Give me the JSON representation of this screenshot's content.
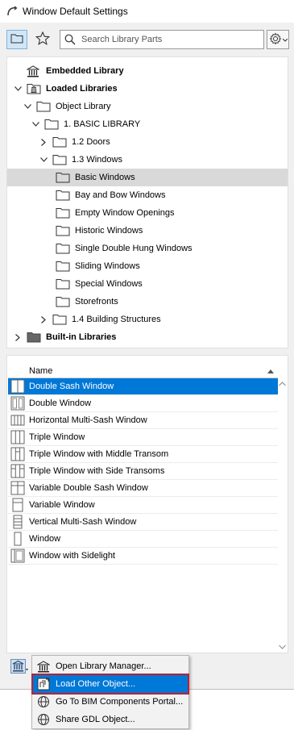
{
  "window": {
    "title": "Window Default Settings"
  },
  "toolbar": {
    "folder_tooltip": "folder-view",
    "favorites_tooltip": "favorites",
    "search_placeholder": "Search Library Parts"
  },
  "tree": {
    "items": [
      {
        "label": "Embedded Library",
        "bold": true
      },
      {
        "label": "Loaded Libraries",
        "bold": true
      },
      {
        "label": "Object Library"
      },
      {
        "label": "1. BASIC LIBRARY"
      },
      {
        "label": "1.2 Doors"
      },
      {
        "label": "1.3 Windows"
      },
      {
        "label": "Basic Windows"
      },
      {
        "label": "Bay and Bow Windows"
      },
      {
        "label": "Empty Window Openings"
      },
      {
        "label": "Historic Windows"
      },
      {
        "label": "Single Double Hung Windows"
      },
      {
        "label": "Sliding Windows"
      },
      {
        "label": "Special Windows"
      },
      {
        "label": "Storefronts"
      },
      {
        "label": "1.4 Building Structures"
      },
      {
        "label": "Built-in Libraries",
        "bold": true
      }
    ]
  },
  "list": {
    "column_name": "Name",
    "rows": [
      "Double Sash Window",
      "Double Window",
      "Horizontal Multi-Sash Window",
      "Triple Window",
      "Triple Window with Middle Transom",
      "Triple Window with Side Transoms",
      "Variable Double Sash Window",
      "Variable Window",
      "Vertical Multi-Sash Window",
      "Window",
      "Window with Sidelight"
    ]
  },
  "menu": {
    "items": [
      "Open Library Manager...",
      "Load Other Object...",
      "Go To BIM Components Portal...",
      "Share GDL Object..."
    ]
  },
  "colors": {
    "selection": "#0078d7",
    "highlight_outline": "#c0202e",
    "tree_selected": "#d9d9d9"
  }
}
